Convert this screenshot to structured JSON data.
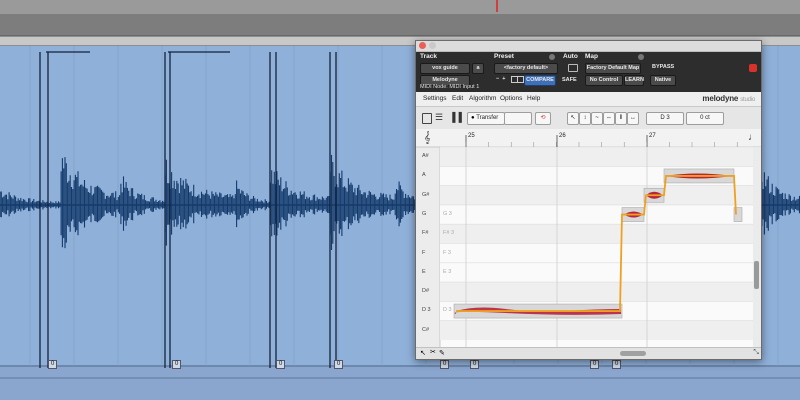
{
  "daw": {
    "region_markers": [
      "0",
      "0",
      "0",
      "0",
      "0",
      "0",
      "0",
      "0"
    ]
  },
  "plugin": {
    "sections": {
      "track": "Track",
      "preset": "Preset",
      "auto": "Auto",
      "map": "Map"
    },
    "track_select": "vox guide",
    "track_letter": "a",
    "plugin_select": "Melodyne",
    "preset_select": "<factory default>",
    "compare_label": "COMPARE",
    "safe_label": "SAFE",
    "map_select": "Factory Default Map",
    "bypass_label": "BYPASS",
    "no_control": "No Control",
    "learn_label": "LEARN",
    "native_select": "Native",
    "midi_node": "MIDI Node: MIDI Input 1",
    "menu": [
      "Settings",
      "Edit",
      "Algorithm",
      "Options",
      "Help"
    ],
    "logo": "melodyne",
    "logo_edition": "studio",
    "transfer_label": "Transfer",
    "pitch_field": "D 3",
    "cents_field": "0 ct",
    "bar_numbers": [
      "25",
      "26",
      "27"
    ],
    "note_labels": [
      "A#",
      "A",
      "G#",
      "G",
      "F#",
      "F",
      "E",
      "D#",
      "D 3",
      "C#"
    ],
    "grid_labels": [
      "G 3",
      "F# 3",
      "F 3",
      "E 3",
      "D 3"
    ]
  },
  "colors": {
    "waveform": "#133a6b",
    "track_bg": "#8fb0d9",
    "blob": "#b8233d",
    "pitch_line": "#f0a020"
  }
}
